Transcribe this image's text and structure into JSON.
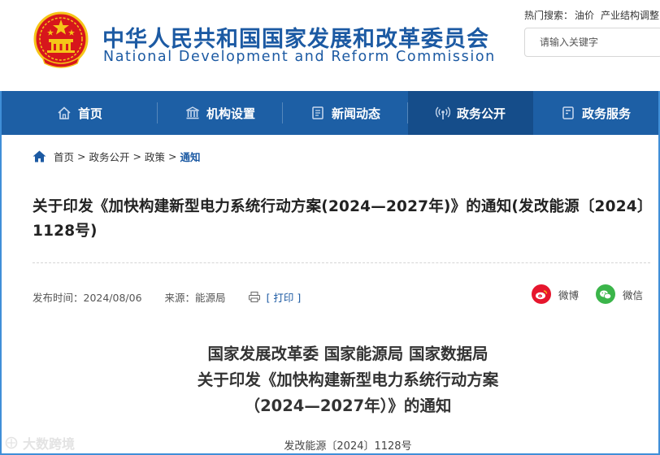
{
  "header": {
    "cn_title": "中华人民共和国国家发展和改革委员会",
    "en_title": "National Development and Reform Commission",
    "hot_label": "热门搜索：",
    "hot_terms": [
      "油价",
      "产业结构调整"
    ],
    "search_placeholder": "请输入关键字"
  },
  "nav": {
    "items": [
      {
        "label": "首页",
        "icon": "home-icon"
      },
      {
        "label": "机构设置",
        "icon": "building-icon"
      },
      {
        "label": "新闻动态",
        "icon": "news-icon"
      },
      {
        "label": "政务公开",
        "icon": "broadcast-icon",
        "active": true
      },
      {
        "label": "政务服务",
        "icon": "service-icon"
      }
    ]
  },
  "breadcrumb": {
    "items": [
      "首页",
      "政务公开",
      "政策",
      "通知"
    ],
    "separator": ">"
  },
  "article": {
    "title": "关于印发《加快构建新型电力系统行动方案(2024—2027年)》的通知(发改能源〔2024〕1128号)",
    "date_label": "发布时间：2024/08/06",
    "source_label": "来源：能源局",
    "print_label": "[ 打印 ]",
    "share_weibo": "微博",
    "share_wechat": "微信",
    "issuers": "国家发展改革委 国家能源局 国家数据局",
    "doc_title_line1": "关于印发《加快构建新型电力系统行动方案",
    "doc_title_line2": "（2024—2027年）》的通知",
    "doc_number": "发改能源〔2024〕1128号"
  },
  "watermark": "大数跨境",
  "colors": {
    "brand_blue": "#1c5aa3",
    "nav_bg": "#1d5fa5",
    "nav_active": "#154d8a",
    "weibo_red": "#e6162d",
    "wechat_green": "#3bb54a",
    "emblem_red": "#d7161c",
    "emblem_gold": "#f5c518"
  }
}
